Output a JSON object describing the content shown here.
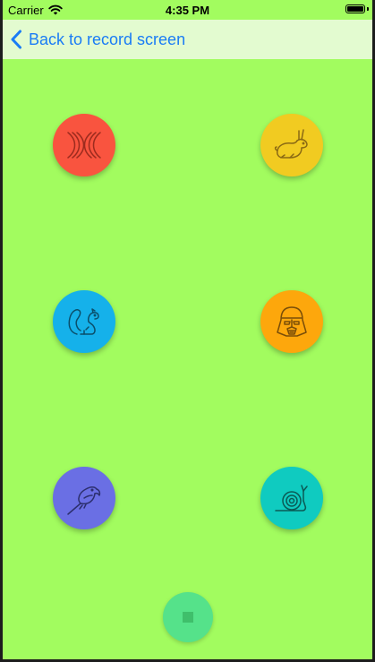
{
  "status_bar": {
    "carrier": "Carrier",
    "time": "4:35 PM"
  },
  "nav": {
    "back_label": "Back to record screen"
  },
  "sound_buttons": [
    {
      "icon": "chipmunk-waves-icon",
      "color": "#f9543f"
    },
    {
      "icon": "rabbit-icon",
      "color": "#f1cb21"
    },
    {
      "icon": "squirrel-icon",
      "color": "#15b1ea"
    },
    {
      "icon": "darth-vader-icon",
      "color": "#fda70c"
    },
    {
      "icon": "parrot-icon",
      "color": "#6a6fe4"
    },
    {
      "icon": "snail-icon",
      "color": "#0fcbc0"
    }
  ],
  "stop_button": {
    "icon": "stop-icon",
    "color": "#55e28a"
  }
}
